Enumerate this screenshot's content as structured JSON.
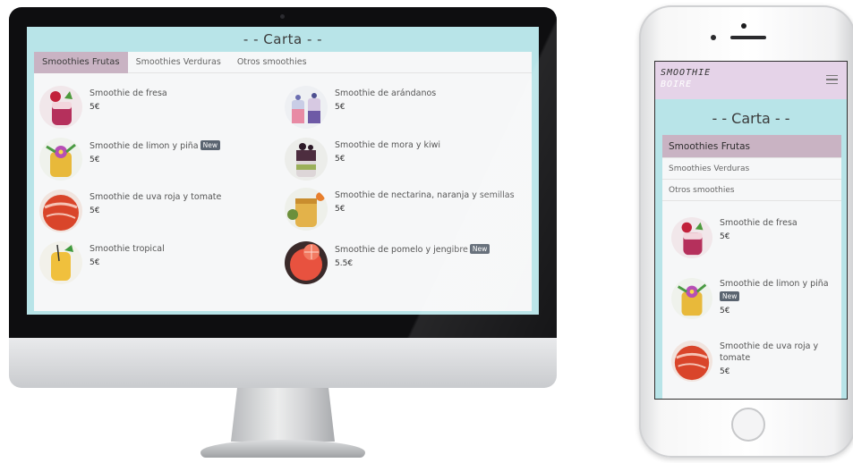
{
  "menu_title": "- - Carta - -",
  "brand": {
    "line1": "SMOOTHIE",
    "line2": "BOIRE"
  },
  "tabs": [
    {
      "label": "Smoothies Frutas",
      "active": true
    },
    {
      "label": "Smoothies Verduras",
      "active": false
    },
    {
      "label": "Otros smoothies",
      "active": false
    }
  ],
  "products": [
    {
      "name": "Smoothie de fresa",
      "price": "5€",
      "badge": "",
      "icon": "strawberry-smoothie-icon"
    },
    {
      "name": "Smoothie de arándanos",
      "price": "5€",
      "badge": "",
      "icon": "blueberry-smoothie-icon"
    },
    {
      "name": "Smoothie de limon y piña",
      "price": "5€",
      "badge": "New",
      "icon": "lemon-pineapple-smoothie-icon"
    },
    {
      "name": "Smoothie de mora y kiwi",
      "price": "5€",
      "badge": "",
      "icon": "blackberry-kiwi-smoothie-icon"
    },
    {
      "name": "Smoothie de uva roja y tomate",
      "price": "5€",
      "badge": "",
      "icon": "grape-tomato-smoothie-icon"
    },
    {
      "name": "Smoothie de nectarina, naranja y semillas",
      "price": "5€",
      "badge": "",
      "icon": "nectarine-orange-smoothie-icon"
    },
    {
      "name": "Smoothie tropical",
      "price": "5€",
      "badge": "",
      "icon": "tropical-smoothie-icon"
    },
    {
      "name": "Smoothie de pomelo y jengibre",
      "price": "5.5€",
      "badge": "New",
      "icon": "grapefruit-ginger-smoothie-icon"
    }
  ],
  "colors": {
    "background": "#b8e4e8",
    "panel": "#f6f7f8",
    "tab_active": "#c9b3c3",
    "header": "#e5d3e8",
    "badge": "#5a6470"
  }
}
